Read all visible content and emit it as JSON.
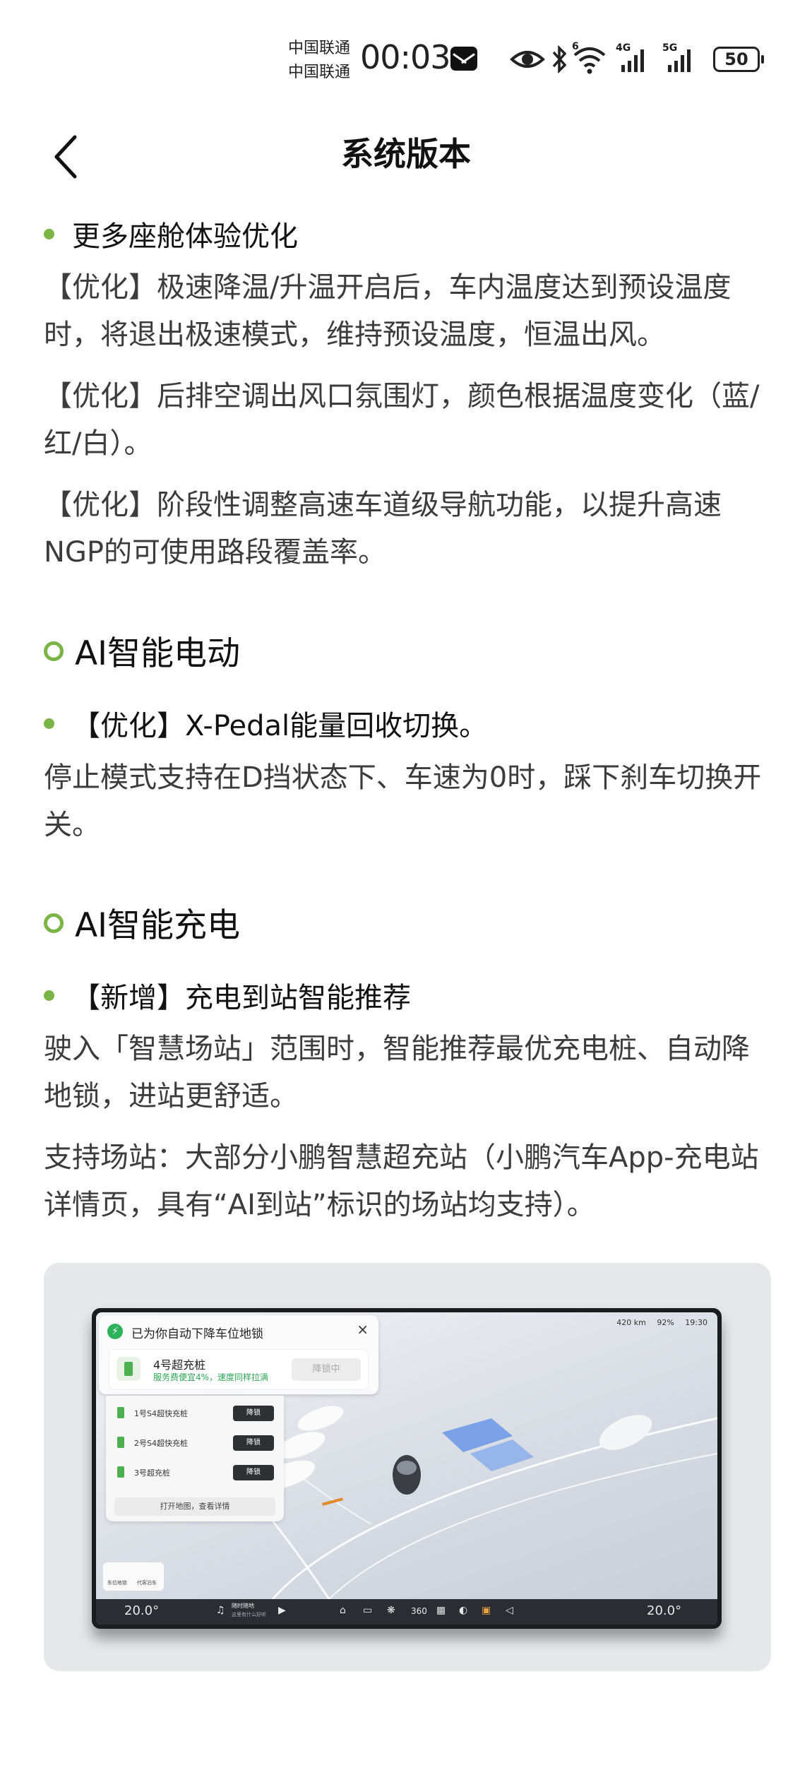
{
  "status_bar": {
    "carrier_1": "中国联通",
    "carrier_2": "中国联通",
    "time": "00:03",
    "battery": "50",
    "net_1": "6",
    "net_2": "4G",
    "net_3": "5G"
  },
  "header": {
    "title": "系统版本"
  },
  "content": {
    "item_cabin": "更多座舱体验优化",
    "cabin_p1": "【优化】极速降温/升温开启后，车内温度达到预设温度时，将退出极速模式，维持预设温度，恒温出风。",
    "cabin_p2": "【优化】后排空调出风口氛围灯，颜色根据温度变化（蓝/红/白）。",
    "cabin_p3": "【优化】阶段性调整高速车道级导航功能，以提升高速NGP的可使用路段覆盖率。",
    "section_power": "AI智能电动",
    "item_xpedal": "【优化】X-Pedal能量回收切换。",
    "xpedal_p1": "停止模式支持在D挡状态下、车速为0时，踩下刹车切换开关。",
    "section_charge": "AI智能充电",
    "item_charge": "【新增】充电到站智能推荐",
    "charge_p1": "驶入「智慧场站」范围时，智能推荐最优充电桩、自动降地锁，进站更舒适。",
    "charge_p2": "支持场站：大部分小鹏智慧超充站（小鹏汽车App-充电站详情页，具有“AI到站”标识的场站均支持）。"
  },
  "screenshot": {
    "notif_title": "已为你自动下降车位地锁",
    "notif_close": "×",
    "charger_name": "4号超充桩",
    "charger_sub": "服务费便宜4%，速度同样拉满",
    "charger_btn": "降锁中",
    "piles": [
      {
        "name": "1号S4超快充桩",
        "btn": "降锁"
      },
      {
        "name": "2号S4超快充桩",
        "btn": "降锁"
      },
      {
        "name": "3号超充桩",
        "btn": "降锁"
      }
    ],
    "map_btn": "打开地图，查看详情",
    "range": "420 km",
    "soc": "92%",
    "clock": "19:30",
    "temp_left": "20.0°",
    "temp_right": "20.0°",
    "mini_1": "车位地锁",
    "mini_2": "代客泊车",
    "dock_media": "随时随地",
    "dock_media_sub": "这里有什么好听",
    "dock_360": "360"
  },
  "colors": {
    "accent_green": "#79b445",
    "text_body": "#3c3c3c",
    "text_title": "#111111"
  },
  "icons": {
    "back": "chevron-left-icon",
    "mail": "mail-icon",
    "eye": "eye-icon",
    "bluetooth": "bluetooth-icon",
    "wifi": "wifi-icon",
    "signal": "signal-icon",
    "battery": "battery-icon"
  }
}
